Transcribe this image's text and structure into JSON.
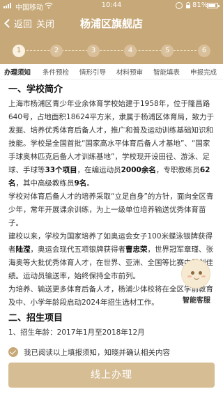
{
  "status_bar": {
    "carrier": "中国移动",
    "time": "10:44",
    "battery": "81%"
  },
  "nav": {
    "back_label": "返回",
    "close_label": "关闭",
    "title": "杨浦区旗舰店"
  },
  "steps": [
    "1",
    "2",
    "3",
    "4",
    "5",
    "6"
  ],
  "tabs": [
    "办理须知",
    "条件预检",
    "情形引导",
    "材料预审",
    "智能填表",
    "申报完成"
  ],
  "content": {
    "section1_title": "一、学校简介",
    "p1": "上海市杨浦区青少年业余体育学校始建于1958年，位于隆昌路640号，占地面积18624平方米，隶属于杨浦区体育局，致力于发掘、培养优秀体育后备人才，推广和普及运动训练基础知识和技能。学校是全国首批“国家高水平体育后备人才基地”、“国家手球奥林匹克后备人才训练基地”，学校现开设田径、游泳、足球、手球等",
    "p1_b1": "33个项目",
    "p1_m1": "，在编运动员",
    "p1_b2": "2000余名",
    "p1_m2": "，专职教练员",
    "p1_b3": "62名",
    "p1_m3": "，其中高级教练员",
    "p1_b4": "9名",
    "p1_end": "。",
    "p2": "学校对体育后备人才的培养采取“立足自身”的方针，面向全区青少年，常年开展课余训练，为上一级单位培养输送优秀体育苗子。",
    "p3_a": "建校以来，学校为国家培养了如奥运会女子100米蝶泳银牌获得者",
    "p3_b1": "陆滢",
    "p3_m1": "，奥运会现代五项银牌获得者",
    "p3_b2": "曹忠荣",
    "p3_end": "，世界冠军章瑾、张海奥等大批优秀体育人才，在世界、亚洲、全国等比赛中屡创佳绩。运动员输送率，始终保持全市前列。",
    "p4": "为培养、输送更多体育后备人才，杨浦少体校将在全区学前教育及中、小学年龄段启动2024年招生选材工作。",
    "section2_title": "二、招生项目",
    "item1": "1、招生年龄：2017年1月至2018年12月"
  },
  "assistant": {
    "label": "智能客服"
  },
  "agreement": {
    "text": "我已阅读以上填报须知，知晓并确认相关内容"
  },
  "submit": {
    "label": "线上办理"
  }
}
